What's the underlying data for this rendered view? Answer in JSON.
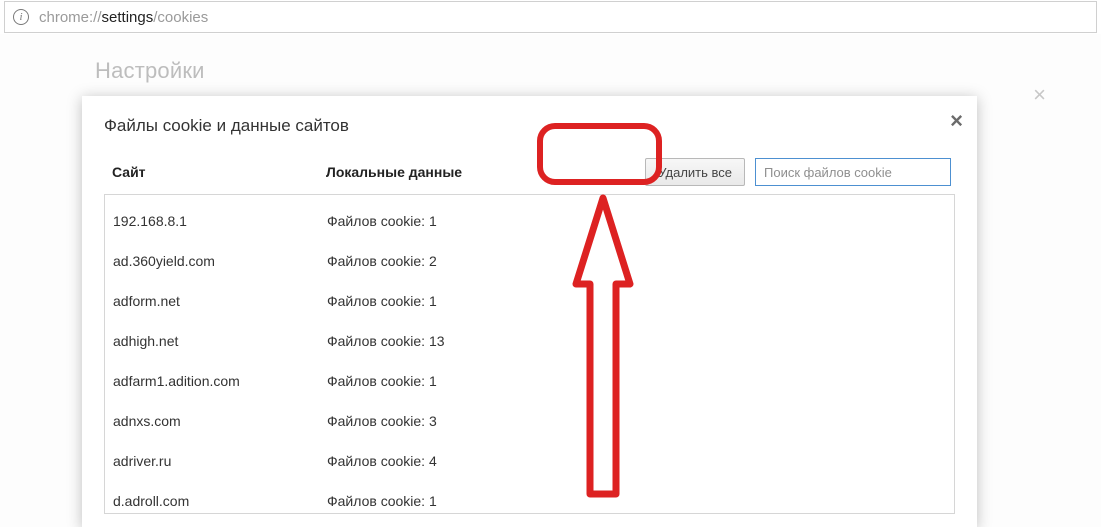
{
  "address_bar": {
    "url_prefix": "chrome://",
    "url_strong": "settings",
    "url_suffix": "/cookies"
  },
  "background": {
    "title": "Настройки"
  },
  "dialog": {
    "title": "Файлы cookie и данные сайтов",
    "col_site": "Сайт",
    "col_local": "Локальные данные",
    "remove_all": "Удалить все",
    "search_placeholder": "Поиск файлов cookie",
    "rows": [
      {
        "site": "192.168.8.1",
        "local": "Файлов cookie: 1"
      },
      {
        "site": "ad.360yield.com",
        "local": "Файлов cookie: 2"
      },
      {
        "site": "adform.net",
        "local": "Файлов cookie: 1"
      },
      {
        "site": "adhigh.net",
        "local": "Файлов cookie: 13"
      },
      {
        "site": "adfarm1.adition.com",
        "local": "Файлов cookie: 1"
      },
      {
        "site": "adnxs.com",
        "local": "Файлов cookie: 3"
      },
      {
        "site": "adriver.ru",
        "local": "Файлов cookie: 4"
      },
      {
        "site": "d.adroll.com",
        "local": "Файлов cookie: 1"
      }
    ]
  }
}
